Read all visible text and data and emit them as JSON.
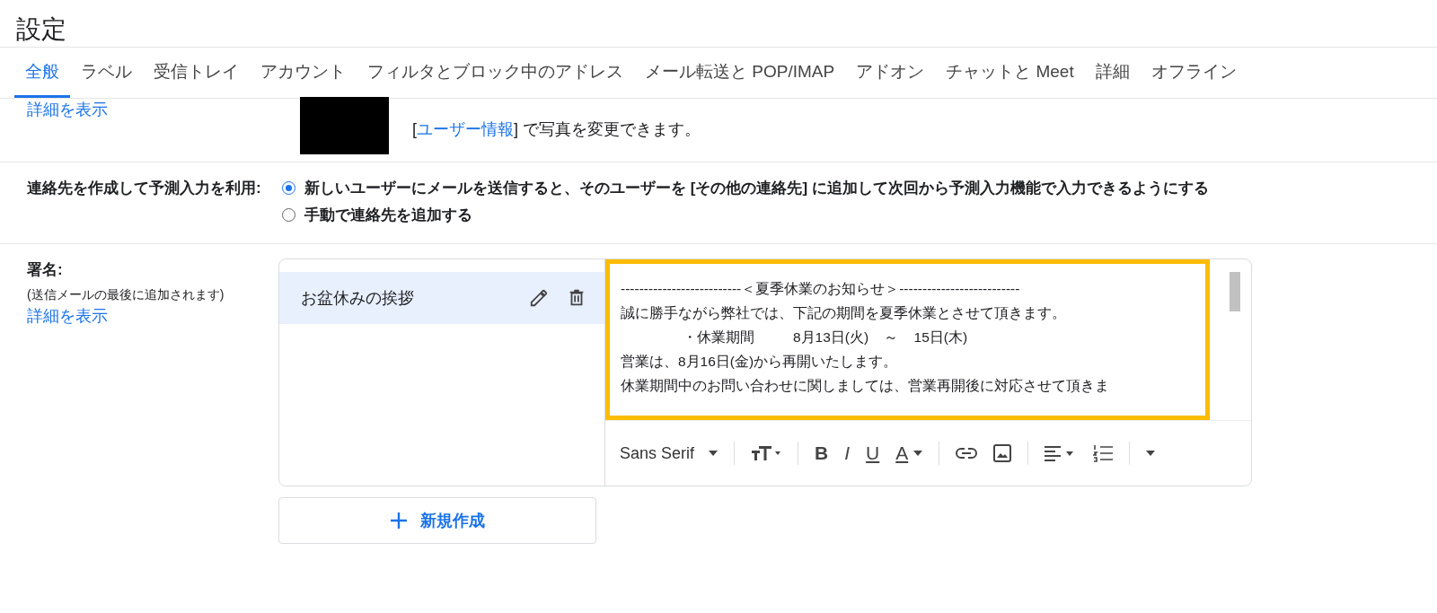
{
  "title": "設定",
  "tabs": [
    {
      "label": "全般",
      "selected": true
    },
    {
      "label": "ラベル",
      "selected": false
    },
    {
      "label": "受信トレイ",
      "selected": false
    },
    {
      "label": "アカウント",
      "selected": false
    },
    {
      "label": "フィルタとブロック中のアドレス",
      "selected": false
    },
    {
      "label": "メール転送と POP/IMAP",
      "selected": false
    },
    {
      "label": "アドオン",
      "selected": false
    },
    {
      "label": "チャットと Meet",
      "selected": false
    },
    {
      "label": "詳細",
      "selected": false
    },
    {
      "label": "オフライン",
      "selected": false
    }
  ],
  "picture_row": {
    "link": "詳細を表示",
    "note_prefix": "[",
    "note_link": "ユーザー情報",
    "note_suffix": "] で写真を変更できます。"
  },
  "contacts": {
    "label": "連絡先を作成して予測入力を利用:",
    "options": [
      {
        "label": "新しいユーザーにメールを送信すると、そのユーザーを [その他の連絡先] に追加して次回から予測入力機能で入力できるようにする",
        "selected": true
      },
      {
        "label": "手動で連絡先を追加する",
        "selected": false
      }
    ]
  },
  "signature": {
    "label": "署名:",
    "hint": "(送信メールの最後に追加されます)",
    "link": "詳細を表示",
    "items": [
      {
        "name": "お盆休みの挨拶",
        "selected": true
      }
    ],
    "body": [
      "--------------------------＜夏季休業のお知らせ＞--------------------------",
      "誠に勝手ながら弊社では、下記の期間を夏季休業とさせて頂きます。",
      "                ・休業期間          8月13日(火)    ～    15日(木)",
      "営業は、8月16日(金)から再開いたします。",
      "休業期間中のお問い合わせに関しましては、営業再開後に対応させて頂きま"
    ],
    "font": "Sans Serif",
    "glyphs": [
      "B",
      "I",
      "U",
      "A"
    ],
    "new_button": "新規作成"
  }
}
